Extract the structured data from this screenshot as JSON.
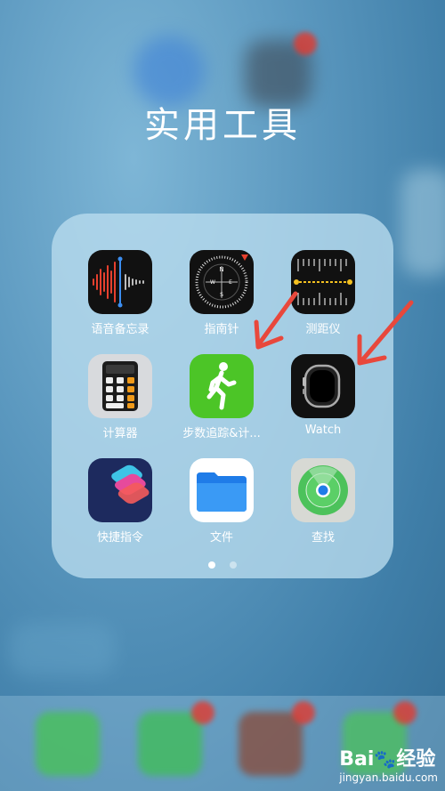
{
  "folder": {
    "title": "实用工具",
    "apps": [
      {
        "label": "语音备忘录",
        "icon": "voice-memos-icon"
      },
      {
        "label": "指南针",
        "icon": "compass-icon"
      },
      {
        "label": "测距仪",
        "icon": "measure-icon"
      },
      {
        "label": "计算器",
        "icon": "calculator-icon"
      },
      {
        "label": "步数追踪&计...",
        "icon": "pedometer-icon"
      },
      {
        "label": "Watch",
        "icon": "watch-icon"
      },
      {
        "label": "快捷指令",
        "icon": "shortcuts-icon"
      },
      {
        "label": "文件",
        "icon": "files-icon"
      },
      {
        "label": "查找",
        "icon": "find-my-icon"
      }
    ],
    "page_count": 2,
    "current_page": 1
  },
  "watermark": {
    "brand": "Bai",
    "brand_suffix": "经验",
    "url": "jingyan.baidu.com"
  },
  "colors": {
    "arrow": "#e8483c",
    "pedometer_green": "#4cc527",
    "shortcuts": "#1d2a5e"
  }
}
